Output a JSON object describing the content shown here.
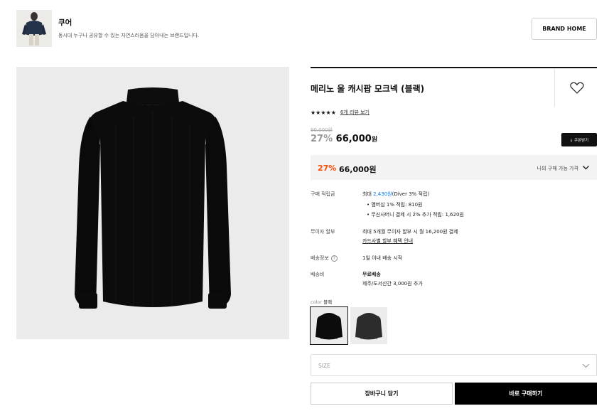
{
  "brand": {
    "name": "쿠어",
    "description": "동시대 누구나 공유할 수 있는 자연스러움을 담아내는 브랜드입니다.",
    "home_button": "BRAND HOME"
  },
  "product": {
    "title": "메리노 울 캐시팝 모크넥 (블랙)",
    "stars": "★★★★★",
    "review_link": "6개 리뷰 보기",
    "original_price": "90,000원",
    "discount_pct": "27%",
    "price": "66,000",
    "price_unit": "원",
    "coupon_button": "↓ 쿠폰받기"
  },
  "my_price": {
    "discount_pct": "27%",
    "amount": "66,000원",
    "label": "나의 구매 가능 가격"
  },
  "details": {
    "points_label": "구매 적립금",
    "points_prefix": "최대 ",
    "points_amount": "2,430원",
    "points_suffix": "(Diver 3% 적립)",
    "points_bullet_1": "•  멤버십 1% 적립: 810원",
    "points_bullet_2": "•  무신사머니 결제 시 2% 추가 적립: 1,620원",
    "installment_label": "무이자 할부",
    "installment_value": "최대 5개월 무이자 할부 시 월 16,200원 결제",
    "installment_link": "카드사별 할부 혜택 안내",
    "shipping_label": "배송정보",
    "shipping_help": "?",
    "shipping_value": "1일 이내 배송 시작",
    "fee_label": "배송비",
    "fee_value": "무료배송",
    "fee_extra": "제주/도서산간 3,000원 추가"
  },
  "options": {
    "color_label": "color",
    "color_value": "블랙",
    "size_placeholder": "SIZE"
  },
  "actions": {
    "cart": "장바구니 담기",
    "buy": "바로 구매하기"
  },
  "colors": {
    "accent_discount": "#ff4800",
    "link_blue": "#0078ff",
    "buy_button": "#000000"
  }
}
